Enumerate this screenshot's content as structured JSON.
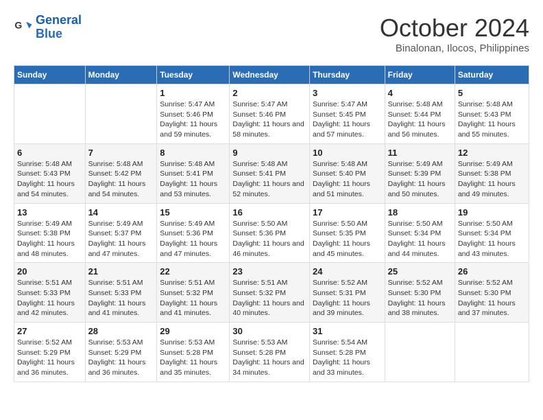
{
  "logo": {
    "line1": "General",
    "line2": "Blue"
  },
  "title": "October 2024",
  "location": "Binalonan, Ilocos, Philippines",
  "days_of_week": [
    "Sunday",
    "Monday",
    "Tuesday",
    "Wednesday",
    "Thursday",
    "Friday",
    "Saturday"
  ],
  "weeks": [
    [
      null,
      null,
      {
        "day": "1",
        "sunrise": "5:47 AM",
        "sunset": "5:46 PM",
        "daylight": "11 hours and 59 minutes."
      },
      {
        "day": "2",
        "sunrise": "5:47 AM",
        "sunset": "5:46 PM",
        "daylight": "11 hours and 58 minutes."
      },
      {
        "day": "3",
        "sunrise": "5:47 AM",
        "sunset": "5:45 PM",
        "daylight": "11 hours and 57 minutes."
      },
      {
        "day": "4",
        "sunrise": "5:48 AM",
        "sunset": "5:44 PM",
        "daylight": "11 hours and 56 minutes."
      },
      {
        "day": "5",
        "sunrise": "5:48 AM",
        "sunset": "5:43 PM",
        "daylight": "11 hours and 55 minutes."
      }
    ],
    [
      {
        "day": "6",
        "sunrise": "5:48 AM",
        "sunset": "5:43 PM",
        "daylight": "11 hours and 54 minutes."
      },
      {
        "day": "7",
        "sunrise": "5:48 AM",
        "sunset": "5:42 PM",
        "daylight": "11 hours and 54 minutes."
      },
      {
        "day": "8",
        "sunrise": "5:48 AM",
        "sunset": "5:41 PM",
        "daylight": "11 hours and 53 minutes."
      },
      {
        "day": "9",
        "sunrise": "5:48 AM",
        "sunset": "5:41 PM",
        "daylight": "11 hours and 52 minutes."
      },
      {
        "day": "10",
        "sunrise": "5:48 AM",
        "sunset": "5:40 PM",
        "daylight": "11 hours and 51 minutes."
      },
      {
        "day": "11",
        "sunrise": "5:49 AM",
        "sunset": "5:39 PM",
        "daylight": "11 hours and 50 minutes."
      },
      {
        "day": "12",
        "sunrise": "5:49 AM",
        "sunset": "5:38 PM",
        "daylight": "11 hours and 49 minutes."
      }
    ],
    [
      {
        "day": "13",
        "sunrise": "5:49 AM",
        "sunset": "5:38 PM",
        "daylight": "11 hours and 48 minutes."
      },
      {
        "day": "14",
        "sunrise": "5:49 AM",
        "sunset": "5:37 PM",
        "daylight": "11 hours and 47 minutes."
      },
      {
        "day": "15",
        "sunrise": "5:49 AM",
        "sunset": "5:36 PM",
        "daylight": "11 hours and 47 minutes."
      },
      {
        "day": "16",
        "sunrise": "5:50 AM",
        "sunset": "5:36 PM",
        "daylight": "11 hours and 46 minutes."
      },
      {
        "day": "17",
        "sunrise": "5:50 AM",
        "sunset": "5:35 PM",
        "daylight": "11 hours and 45 minutes."
      },
      {
        "day": "18",
        "sunrise": "5:50 AM",
        "sunset": "5:34 PM",
        "daylight": "11 hours and 44 minutes."
      },
      {
        "day": "19",
        "sunrise": "5:50 AM",
        "sunset": "5:34 PM",
        "daylight": "11 hours and 43 minutes."
      }
    ],
    [
      {
        "day": "20",
        "sunrise": "5:51 AM",
        "sunset": "5:33 PM",
        "daylight": "11 hours and 42 minutes."
      },
      {
        "day": "21",
        "sunrise": "5:51 AM",
        "sunset": "5:33 PM",
        "daylight": "11 hours and 41 minutes."
      },
      {
        "day": "22",
        "sunrise": "5:51 AM",
        "sunset": "5:32 PM",
        "daylight": "11 hours and 41 minutes."
      },
      {
        "day": "23",
        "sunrise": "5:51 AM",
        "sunset": "5:32 PM",
        "daylight": "11 hours and 40 minutes."
      },
      {
        "day": "24",
        "sunrise": "5:52 AM",
        "sunset": "5:31 PM",
        "daylight": "11 hours and 39 minutes."
      },
      {
        "day": "25",
        "sunrise": "5:52 AM",
        "sunset": "5:30 PM",
        "daylight": "11 hours and 38 minutes."
      },
      {
        "day": "26",
        "sunrise": "5:52 AM",
        "sunset": "5:30 PM",
        "daylight": "11 hours and 37 minutes."
      }
    ],
    [
      {
        "day": "27",
        "sunrise": "5:52 AM",
        "sunset": "5:29 PM",
        "daylight": "11 hours and 36 minutes."
      },
      {
        "day": "28",
        "sunrise": "5:53 AM",
        "sunset": "5:29 PM",
        "daylight": "11 hours and 36 minutes."
      },
      {
        "day": "29",
        "sunrise": "5:53 AM",
        "sunset": "5:28 PM",
        "daylight": "11 hours and 35 minutes."
      },
      {
        "day": "30",
        "sunrise": "5:53 AM",
        "sunset": "5:28 PM",
        "daylight": "11 hours and 34 minutes."
      },
      {
        "day": "31",
        "sunrise": "5:54 AM",
        "sunset": "5:28 PM",
        "daylight": "11 hours and 33 minutes."
      },
      null,
      null
    ]
  ]
}
